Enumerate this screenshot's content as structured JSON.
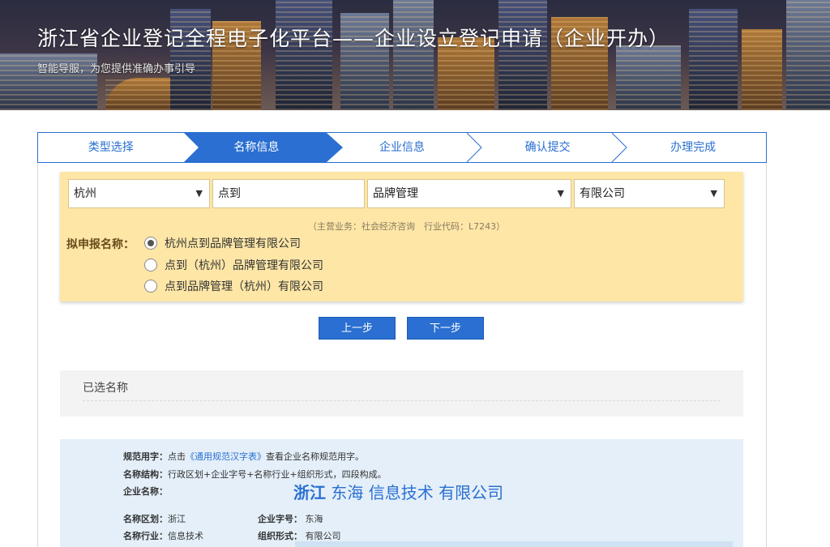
{
  "header": {
    "title": "浙江省企业登记全程电子化平台——企业设立登记申请（企业开办）",
    "subtitle": "智能导服，为您提供准确办事引导"
  },
  "steps": [
    {
      "label": "类型选择",
      "active": false
    },
    {
      "label": "名称信息",
      "active": true
    },
    {
      "label": "企业信息",
      "active": false
    },
    {
      "label": "确认提交",
      "active": false
    },
    {
      "label": "办理完成",
      "active": false
    }
  ],
  "name_form": {
    "region": "杭州",
    "brand": "点到",
    "industry": "品牌管理",
    "org_form": "有限公司",
    "hint": "（主营业务：社会经济咨询　行业代码：L7243）",
    "proposal_label": "拟申报名称：",
    "options": [
      {
        "label": "杭州点到品牌管理有限公司",
        "selected": true
      },
      {
        "label": "点到（杭州）品牌管理有限公司",
        "selected": false
      },
      {
        "label": "点到品牌管理（杭州）有限公司",
        "selected": false
      }
    ]
  },
  "buttons": {
    "prev": "上一步",
    "next": "下一步"
  },
  "selected_names": {
    "label": "已选名称"
  },
  "guide": {
    "standard_label": "规范用字：",
    "standard_text_pre": "点击",
    "standard_link": "《通用规范汉字表》",
    "standard_text_post": "查看企业名称规范用字。",
    "structure_label": "名称结构：",
    "structure_text": "行政区划+企业字号+名称行业+组织形式，四段构成。",
    "example_label": "企业名称：",
    "example_parts": [
      "浙江",
      "东海",
      "信息技术",
      "有限公司"
    ],
    "region_label": "名称区划：",
    "region_value": "浙江",
    "brand_label": "企业字号：",
    "brand_value": "东海",
    "industry_label": "名称行业：",
    "industry_value": "信息技术",
    "org_label": "组织形式：",
    "org_value": "有限公司"
  },
  "colors": {
    "primary": "#2a6fd1",
    "name_box_bg": "#fde6a6",
    "guide_bg": "#e4eff9"
  }
}
